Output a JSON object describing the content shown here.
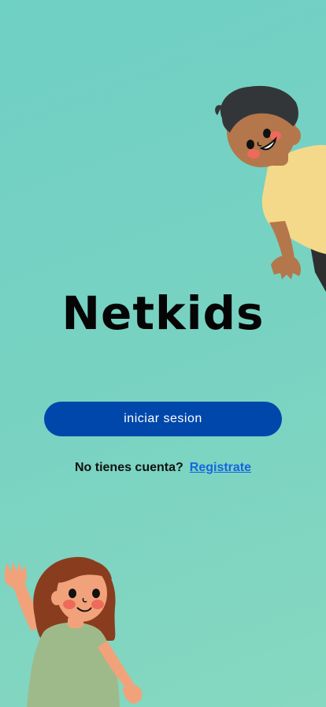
{
  "app": {
    "title": "Netkids"
  },
  "actions": {
    "login_label": "iniciar sesion"
  },
  "signup": {
    "prompt": "No tienes cuenta?",
    "link_label": "Registrate"
  },
  "colors": {
    "background": "#78d2c2",
    "primary_button": "#0047ab",
    "link": "#1565e0"
  },
  "illustrations": {
    "top_right": "boy-waving-illustration",
    "bottom_left": "girl-waving-illustration"
  }
}
